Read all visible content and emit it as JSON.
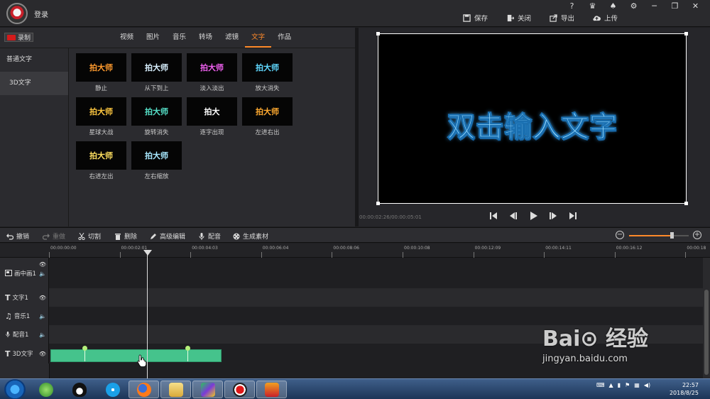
{
  "header": {
    "login": "登录",
    "controls": [
      "?",
      "♛",
      "♠",
      "⚙",
      "─",
      "❐",
      "✕"
    ],
    "actions": [
      {
        "label": "保存",
        "icon": "save-icon"
      },
      {
        "label": "关闭",
        "icon": "close-door-icon"
      },
      {
        "label": "导出",
        "icon": "export-icon"
      },
      {
        "label": "上传",
        "icon": "upload-cloud-icon"
      }
    ]
  },
  "left": {
    "record_label": "录制",
    "tabs": [
      "视频",
      "图片",
      "音乐",
      "转场",
      "滤镜",
      "文字",
      "作品"
    ],
    "active_tab": "文字",
    "categories": [
      "普通文字",
      "3D文字"
    ],
    "selected_category": "3D文字",
    "tiles": [
      {
        "thumb": "拍大师",
        "label": "静止",
        "color": "#ff9b2e"
      },
      {
        "thumb": "拍大师",
        "label": "从下到上",
        "color": "#d9f0ff"
      },
      {
        "thumb": "拍大师",
        "label": "淡入淡出",
        "color": "#f060f0"
      },
      {
        "thumb": "拍大师",
        "label": "放大消失",
        "color": "#60d8ff"
      },
      {
        "thumb": "拍大师",
        "label": "星球大战",
        "color": "#ffc840"
      },
      {
        "thumb": "拍大师",
        "label": "旋转消失",
        "color": "#56e0c8"
      },
      {
        "thumb": "拍大",
        "label": "逐字出现",
        "color": "#ffffff"
      },
      {
        "thumb": "拍大师",
        "label": "左进右出",
        "color": "#ffaa30"
      },
      {
        "thumb": "拍大师",
        "label": "右进左出",
        "color": "#ffe060"
      },
      {
        "thumb": "拍大师",
        "label": "左右缩放",
        "color": "#a8e8ff"
      }
    ]
  },
  "preview": {
    "text": "双击输入文字",
    "timecode": "00:00:02:26/00:00:05:01"
  },
  "toolbar": {
    "items": [
      {
        "label": "撤销",
        "icon": "undo-icon",
        "enabled": true
      },
      {
        "label": "重做",
        "icon": "redo-icon",
        "enabled": false
      },
      {
        "label": "切割",
        "icon": "scissors-icon",
        "enabled": true
      },
      {
        "label": "删除",
        "icon": "trash-icon",
        "enabled": true
      },
      {
        "label": "高级编辑",
        "icon": "pencil-icon",
        "enabled": true
      },
      {
        "label": "配音",
        "icon": "microphone-icon",
        "enabled": true
      },
      {
        "label": "生成素材",
        "icon": "film-reel-icon",
        "enabled": true
      }
    ],
    "zoom_minus": "−",
    "zoom_plus": "+",
    "zoom_level": 0.72
  },
  "timeline": {
    "ticks": [
      "00:00:00:00",
      "00:00:02:01",
      "00:00:04:03",
      "00:00:06:04",
      "00:00:08:06",
      "00:00:10:08",
      "00:00:12:09",
      "00:00:14:11",
      "00:00:16:12",
      "00:00:18"
    ],
    "tracks": [
      {
        "label": "画中画1",
        "icon": "pip-icon"
      },
      {
        "label": "文字1",
        "icon": "text-t-icon"
      },
      {
        "label": "音乐1",
        "icon": "music-note-icon"
      },
      {
        "label": "配音1",
        "icon": "microphone-icon"
      },
      {
        "label": "3D文字",
        "icon": "text-t-icon"
      }
    ]
  },
  "taskbar": {
    "apps": [
      "green-circle-app-icon",
      "qq-penguin-icon",
      "media-reel-icon",
      "firefox-icon",
      "folder-icon",
      "monitor-app-icon",
      "record-app-icon",
      "video-editor-app-icon"
    ],
    "time": "22:57",
    "date": "2018/8/25"
  },
  "watermark": {
    "brand": "Bai⊙ 经验",
    "url": "jingyan.baidu.com"
  }
}
